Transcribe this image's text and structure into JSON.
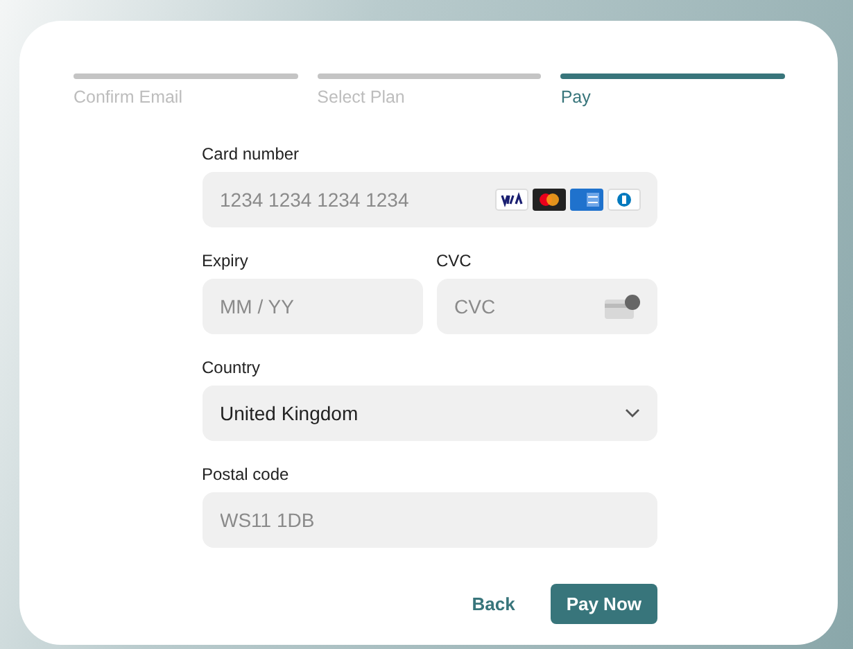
{
  "steps": [
    {
      "label": "Confirm Email",
      "selected": false
    },
    {
      "label": "Select Plan",
      "selected": false
    },
    {
      "label": "Pay",
      "selected": true
    }
  ],
  "form": {
    "card_number": {
      "label": "Card number",
      "placeholder": "1234 1234 1234 1234"
    },
    "expiry": {
      "label": "Expiry",
      "placeholder": "MM / YY"
    },
    "cvc": {
      "label": "CVC",
      "placeholder": "CVC"
    },
    "country": {
      "label": "Country",
      "value": "United Kingdom"
    },
    "postal_code": {
      "label": "Postal code",
      "placeholder": "WS11 1DB"
    }
  },
  "buttons": {
    "back": "Back",
    "submit": "Pay Now"
  }
}
